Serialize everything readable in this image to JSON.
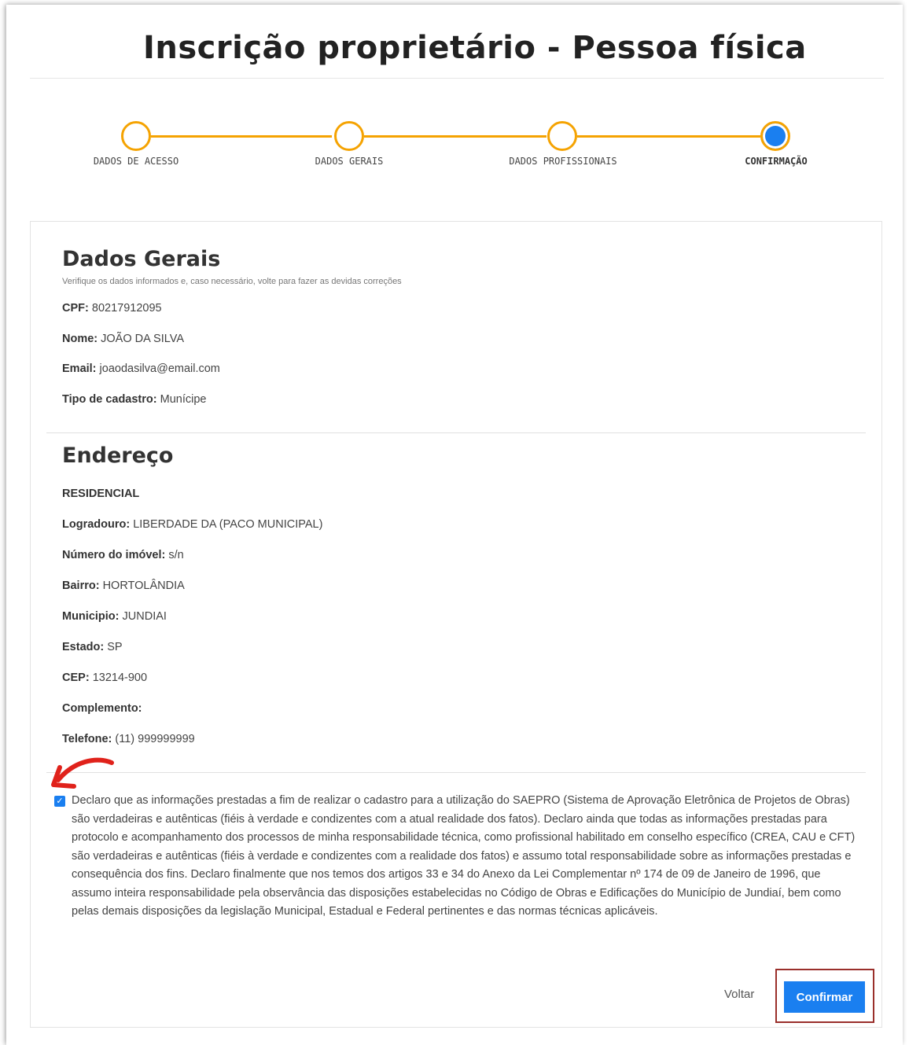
{
  "header": {
    "title": "Inscrição proprietário - Pessoa física"
  },
  "stepper": {
    "steps": [
      {
        "label": "DADOS DE ACESSO",
        "active": false
      },
      {
        "label": "DADOS GERAIS",
        "active": false
      },
      {
        "label": "DADOS PROFISSIONAIS",
        "active": false
      },
      {
        "label": "CONFIRMAÇÃO",
        "active": true
      }
    ]
  },
  "dados_gerais": {
    "title": "Dados Gerais",
    "subtitle": "Verifique os dados informados e, caso necessário, volte para fazer as devidas correções",
    "fields": [
      {
        "label": "CPF:",
        "value": "80217912095"
      },
      {
        "label": "Nome:",
        "value": "JOÃO DA SILVA"
      },
      {
        "label": "Email:",
        "value": "joaodasilva@email.com"
      },
      {
        "label": "Tipo de cadastro:",
        "value": "Munícipe"
      }
    ]
  },
  "endereco": {
    "title": "Endereço",
    "type": "RESIDENCIAL",
    "fields": [
      {
        "label": "Logradouro:",
        "value": "LIBERDADE DA (PACO MUNICIPAL)"
      },
      {
        "label": "Número do imóvel:",
        "value": "s/n"
      },
      {
        "label": "Bairro:",
        "value": "HORTOLÂNDIA"
      },
      {
        "label": "Municipio:",
        "value": "JUNDIAI"
      },
      {
        "label": "Estado:",
        "value": "SP"
      },
      {
        "label": "CEP:",
        "value": "13214-900"
      },
      {
        "label": "Complemento:",
        "value": ""
      },
      {
        "label": "Telefone:",
        "value": "(11) 999999999"
      }
    ]
  },
  "consent": {
    "checked": true,
    "text": "Declaro que as informações prestadas a fim de realizar o cadastro para a utilização do SAEPRO (Sistema de Aprovação Eletrônica de Projetos de Obras) são verdadeiras e autênticas (fiéis à verdade e condizentes com a atual realidade dos fatos). Declaro ainda que todas as informações prestadas para protocolo e acompanhamento dos processos de minha responsabilidade técnica, como profissional habilitado em conselho específico (CREA, CAU e CFT) são verdadeiras e autênticas (fiéis à verdade e condizentes com a realidade dos fatos) e assumo total responsabilidade sobre as informações prestadas e consequência dos fins. Declaro finalmente que nos temos dos artigos 33 e 34 do Anexo da Lei Complementar nº 174 de 09 de Janeiro de 1996, que assumo inteira responsabilidade pela observância das disposições estabelecidas no Código de Obras e Edificações do Município de Jundiaí, bem como pelas demais disposições da legislação Municipal, Estadual e Federal pertinentes e das normas técnicas aplicáveis."
  },
  "actions": {
    "back_label": "Voltar",
    "confirm_label": "Confirmar"
  },
  "colors": {
    "accent": "#1a7ff0",
    "stepper": "#f5a302",
    "highlight_frame": "#9a2f2b",
    "arrow": "#e0221b"
  },
  "icons": {
    "check": "check-icon",
    "annotation": "red-arrow-icon"
  }
}
